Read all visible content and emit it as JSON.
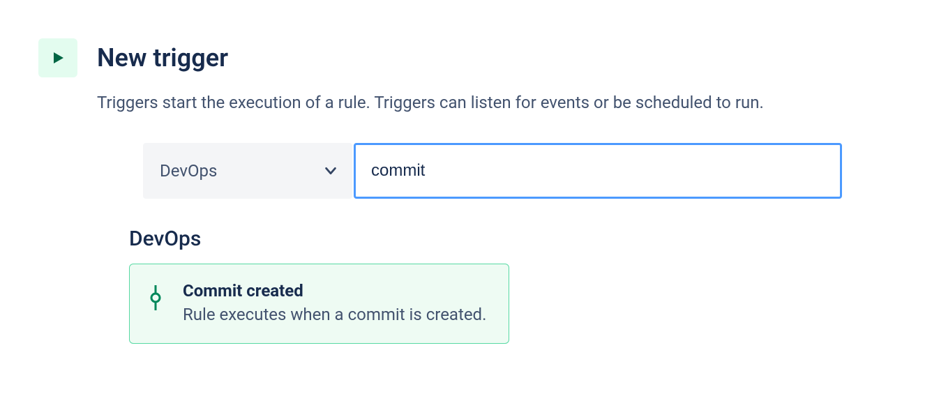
{
  "header": {
    "title": "New trigger",
    "description": "Triggers start the execution of a rule. Triggers can listen for events or be scheduled to run."
  },
  "filter": {
    "dropdown_label": "DevOps",
    "search_value": "commit"
  },
  "category": {
    "title": "DevOps"
  },
  "result": {
    "title": "Commit created",
    "description": "Rule executes when a commit is created."
  }
}
